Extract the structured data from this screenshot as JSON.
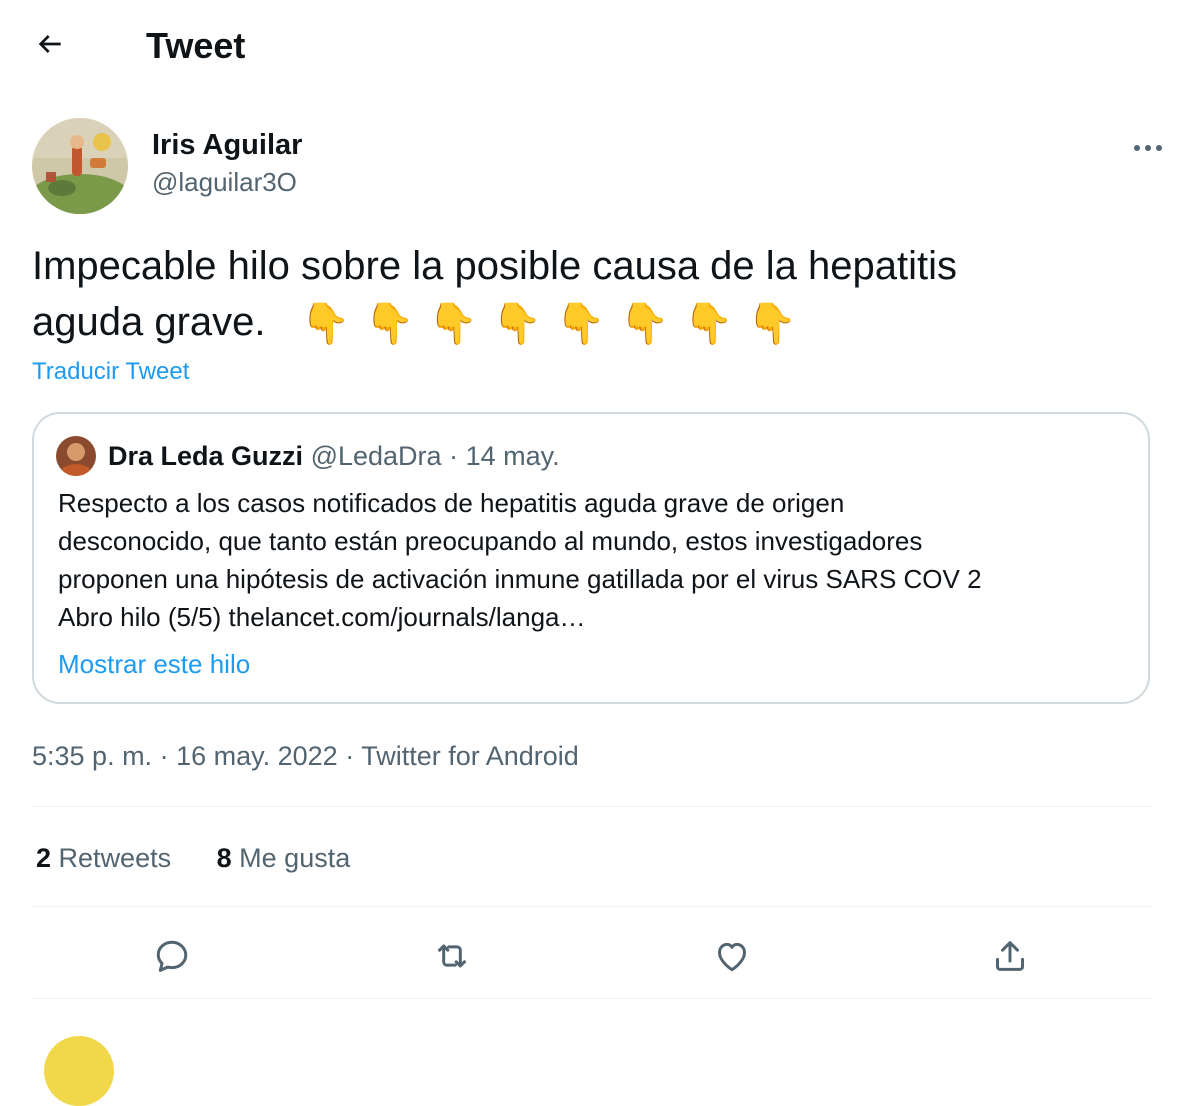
{
  "header": {
    "back_icon": "arrow-left-icon",
    "title": "Tweet"
  },
  "author": {
    "name": "Iris Aguilar",
    "handle": "@laguilar3O",
    "more_icon": "more-horizontal-icon"
  },
  "tweet": {
    "text_line1": "Impecable hilo sobre la posible causa de la hepatitis",
    "text_line2": "aguda grave.",
    "emoji": [
      "👇",
      "👇",
      "👇",
      "👇",
      "👇",
      "👇",
      "👇",
      "👇"
    ],
    "translate_label": "Traducir Tweet"
  },
  "quote": {
    "name": "Dra Leda Guzzi",
    "handle": "@LedaDra",
    "separator": " · ",
    "date": "14 may.",
    "lines": [
      "Respecto a los casos notificados de hepatitis aguda grave de origen",
      "desconocido, que tanto están preocupando al mundo, estos investigadores",
      "proponen una hipótesis de activación inmune gatillada por el virus SARS COV 2",
      "Abro hilo (5/5) thelancet.com/journals/langa…"
    ],
    "show_thread": "Mostrar este hilo"
  },
  "meta": {
    "time": "5:35 p. m.",
    "sep": " · ",
    "date": "16 may. 2022",
    "source": "Twitter for Android"
  },
  "stats": {
    "retweets_count": "2",
    "retweets_label": "Retweets",
    "likes_count": "8",
    "likes_label": "Me gusta"
  },
  "actions": {
    "reply_icon": "reply-icon",
    "retweet_icon": "retweet-icon",
    "like_icon": "heart-icon",
    "share_icon": "share-icon"
  },
  "colors": {
    "accent": "#1d9bf0",
    "text": "#0f1419",
    "secondary": "#536471",
    "border": "#cfd9de"
  }
}
